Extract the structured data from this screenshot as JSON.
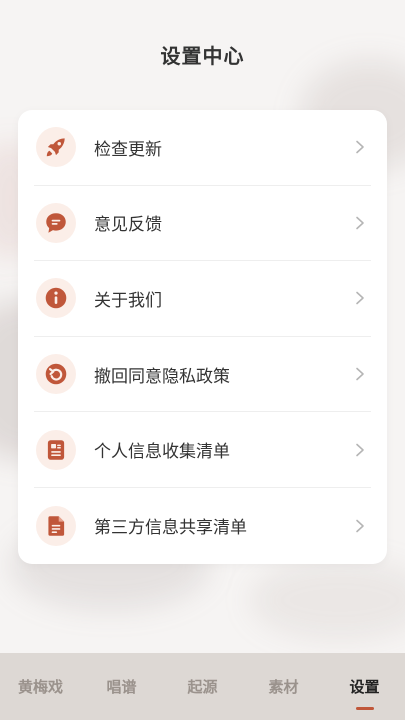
{
  "header": {
    "title": "设置中心"
  },
  "menu": {
    "items": [
      {
        "label": "检查更新",
        "icon": "rocket-icon"
      },
      {
        "label": "意见反馈",
        "icon": "chat-bubble-icon"
      },
      {
        "label": "关于我们",
        "icon": "info-icon"
      },
      {
        "label": "撤回同意隐私政策",
        "icon": "undo-icon"
      },
      {
        "label": "个人信息收集清单",
        "icon": "list-doc-icon"
      },
      {
        "label": "第三方信息共享清单",
        "icon": "document-icon"
      }
    ]
  },
  "tabs": [
    {
      "label": "黄梅戏",
      "active": false
    },
    {
      "label": "唱谱",
      "active": false
    },
    {
      "label": "起源",
      "active": false
    },
    {
      "label": "素材",
      "active": false
    },
    {
      "label": "设置",
      "active": true
    }
  ],
  "colors": {
    "accent": "#c0573a",
    "icon_bg": "#fbeee8",
    "tabbar_bg": "#ddd8d4"
  }
}
